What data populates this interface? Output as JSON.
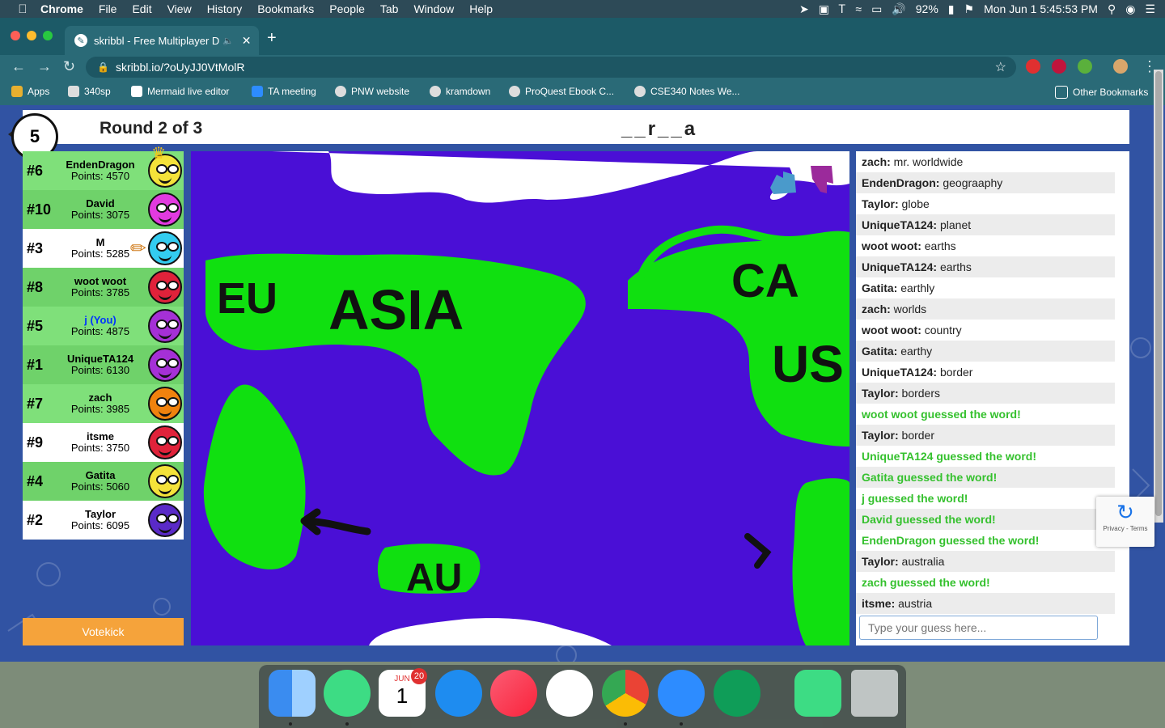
{
  "menubar": {
    "app": "Chrome",
    "items": [
      "File",
      "Edit",
      "View",
      "History",
      "Bookmarks",
      "People",
      "Tab",
      "Window",
      "Help"
    ],
    "battery": "92%",
    "datetime": "Mon Jun 1  5:45:53 PM"
  },
  "tab": {
    "title": "skribbl - Free Multiplayer D"
  },
  "address": {
    "url": "skribbl.io/?oUyJJ0VtMolR"
  },
  "bookmarks": [
    "Apps",
    "340sp",
    "Mermaid live editor",
    "TA meeting",
    "PNW website",
    "kramdown",
    "ProQuest Ebook C...",
    "CSE340 Notes We...",
    "Other Bookmarks"
  ],
  "game": {
    "timer": "5",
    "round": "Round 2 of 3",
    "word_hint": "__r__a"
  },
  "players": [
    {
      "rank": "#6",
      "name": "EndenDragon",
      "points": "Points: 4570",
      "color": "#f4e23a",
      "bg": "green"
    },
    {
      "rank": "#10",
      "name": "David",
      "points": "Points: 3075",
      "color": "#e23ae0",
      "bg": "alt"
    },
    {
      "rank": "#3",
      "name": "M",
      "points": "Points: 5285",
      "color": "#33ccf0",
      "bg": "white"
    },
    {
      "rank": "#8",
      "name": "woot woot",
      "points": "Points: 3785",
      "color": "#e0223a",
      "bg": "alt"
    },
    {
      "rank": "#5",
      "name": "j (You)",
      "points": "Points: 4875",
      "color": "#a530d6",
      "bg": "green"
    },
    {
      "rank": "#1",
      "name": "UniqueTA124",
      "points": "Points: 6130",
      "color": "#a530d6",
      "bg": "alt"
    },
    {
      "rank": "#7",
      "name": "zach",
      "points": "Points: 3985",
      "color": "#f0820e",
      "bg": "green"
    },
    {
      "rank": "#9",
      "name": "itsme",
      "points": "Points: 3750",
      "color": "#e0223a",
      "bg": "white"
    },
    {
      "rank": "#4",
      "name": "Gatita",
      "points": "Points: 5060",
      "color": "#f4e23a",
      "bg": "alt"
    },
    {
      "rank": "#2",
      "name": "Taylor",
      "points": "Points: 6095",
      "color": "#5a2ac8",
      "bg": "white"
    }
  ],
  "votekick": "Votekick",
  "drawing_text": [
    "EU",
    "ASIA",
    "CA",
    "US",
    "AU"
  ],
  "chat": [
    {
      "user": "zach:",
      "text": " mr. worldwide",
      "guess": false
    },
    {
      "user": "EndenDragon:",
      "text": " geograaphy",
      "guess": false
    },
    {
      "user": "Taylor:",
      "text": " globe",
      "guess": false
    },
    {
      "user": "UniqueTA124:",
      "text": " planet",
      "guess": false
    },
    {
      "user": "woot woot:",
      "text": " earths",
      "guess": false
    },
    {
      "user": "UniqueTA124:",
      "text": " earths",
      "guess": false
    },
    {
      "user": "Gatita:",
      "text": " earthly",
      "guess": false
    },
    {
      "user": "zach:",
      "text": " worlds",
      "guess": false
    },
    {
      "user": "woot woot:",
      "text": " country",
      "guess": false
    },
    {
      "user": "Gatita:",
      "text": " earthy",
      "guess": false
    },
    {
      "user": "UniqueTA124:",
      "text": " border",
      "guess": false
    },
    {
      "user": "Taylor:",
      "text": " borders",
      "guess": false
    },
    {
      "user": "",
      "text": "woot woot guessed the word!",
      "guess": true
    },
    {
      "user": "Taylor:",
      "text": " border",
      "guess": false
    },
    {
      "user": "",
      "text": "UniqueTA124 guessed the word!",
      "guess": true
    },
    {
      "user": "",
      "text": "Gatita guessed the word!",
      "guess": true
    },
    {
      "user": "",
      "text": "j guessed the word!",
      "guess": true
    },
    {
      "user": "",
      "text": "David guessed the word!",
      "guess": true
    },
    {
      "user": "",
      "text": "EndenDragon guessed the word!",
      "guess": true
    },
    {
      "user": "Taylor:",
      "text": " australia",
      "guess": false
    },
    {
      "user": "",
      "text": "zach guessed the word!",
      "guess": true
    },
    {
      "user": "itsme:",
      "text": " austria",
      "guess": false
    }
  ],
  "guess_placeholder": "Type your guess here...",
  "recaptcha": "Privacy - Terms",
  "dock": {
    "calendar_month": "JUN",
    "calendar_day": "1",
    "calendar_badge": "20"
  },
  "colors": {
    "canvas_blue": "#4a0fd6",
    "land_green": "#10e010",
    "page_bg": "#3153a3"
  }
}
